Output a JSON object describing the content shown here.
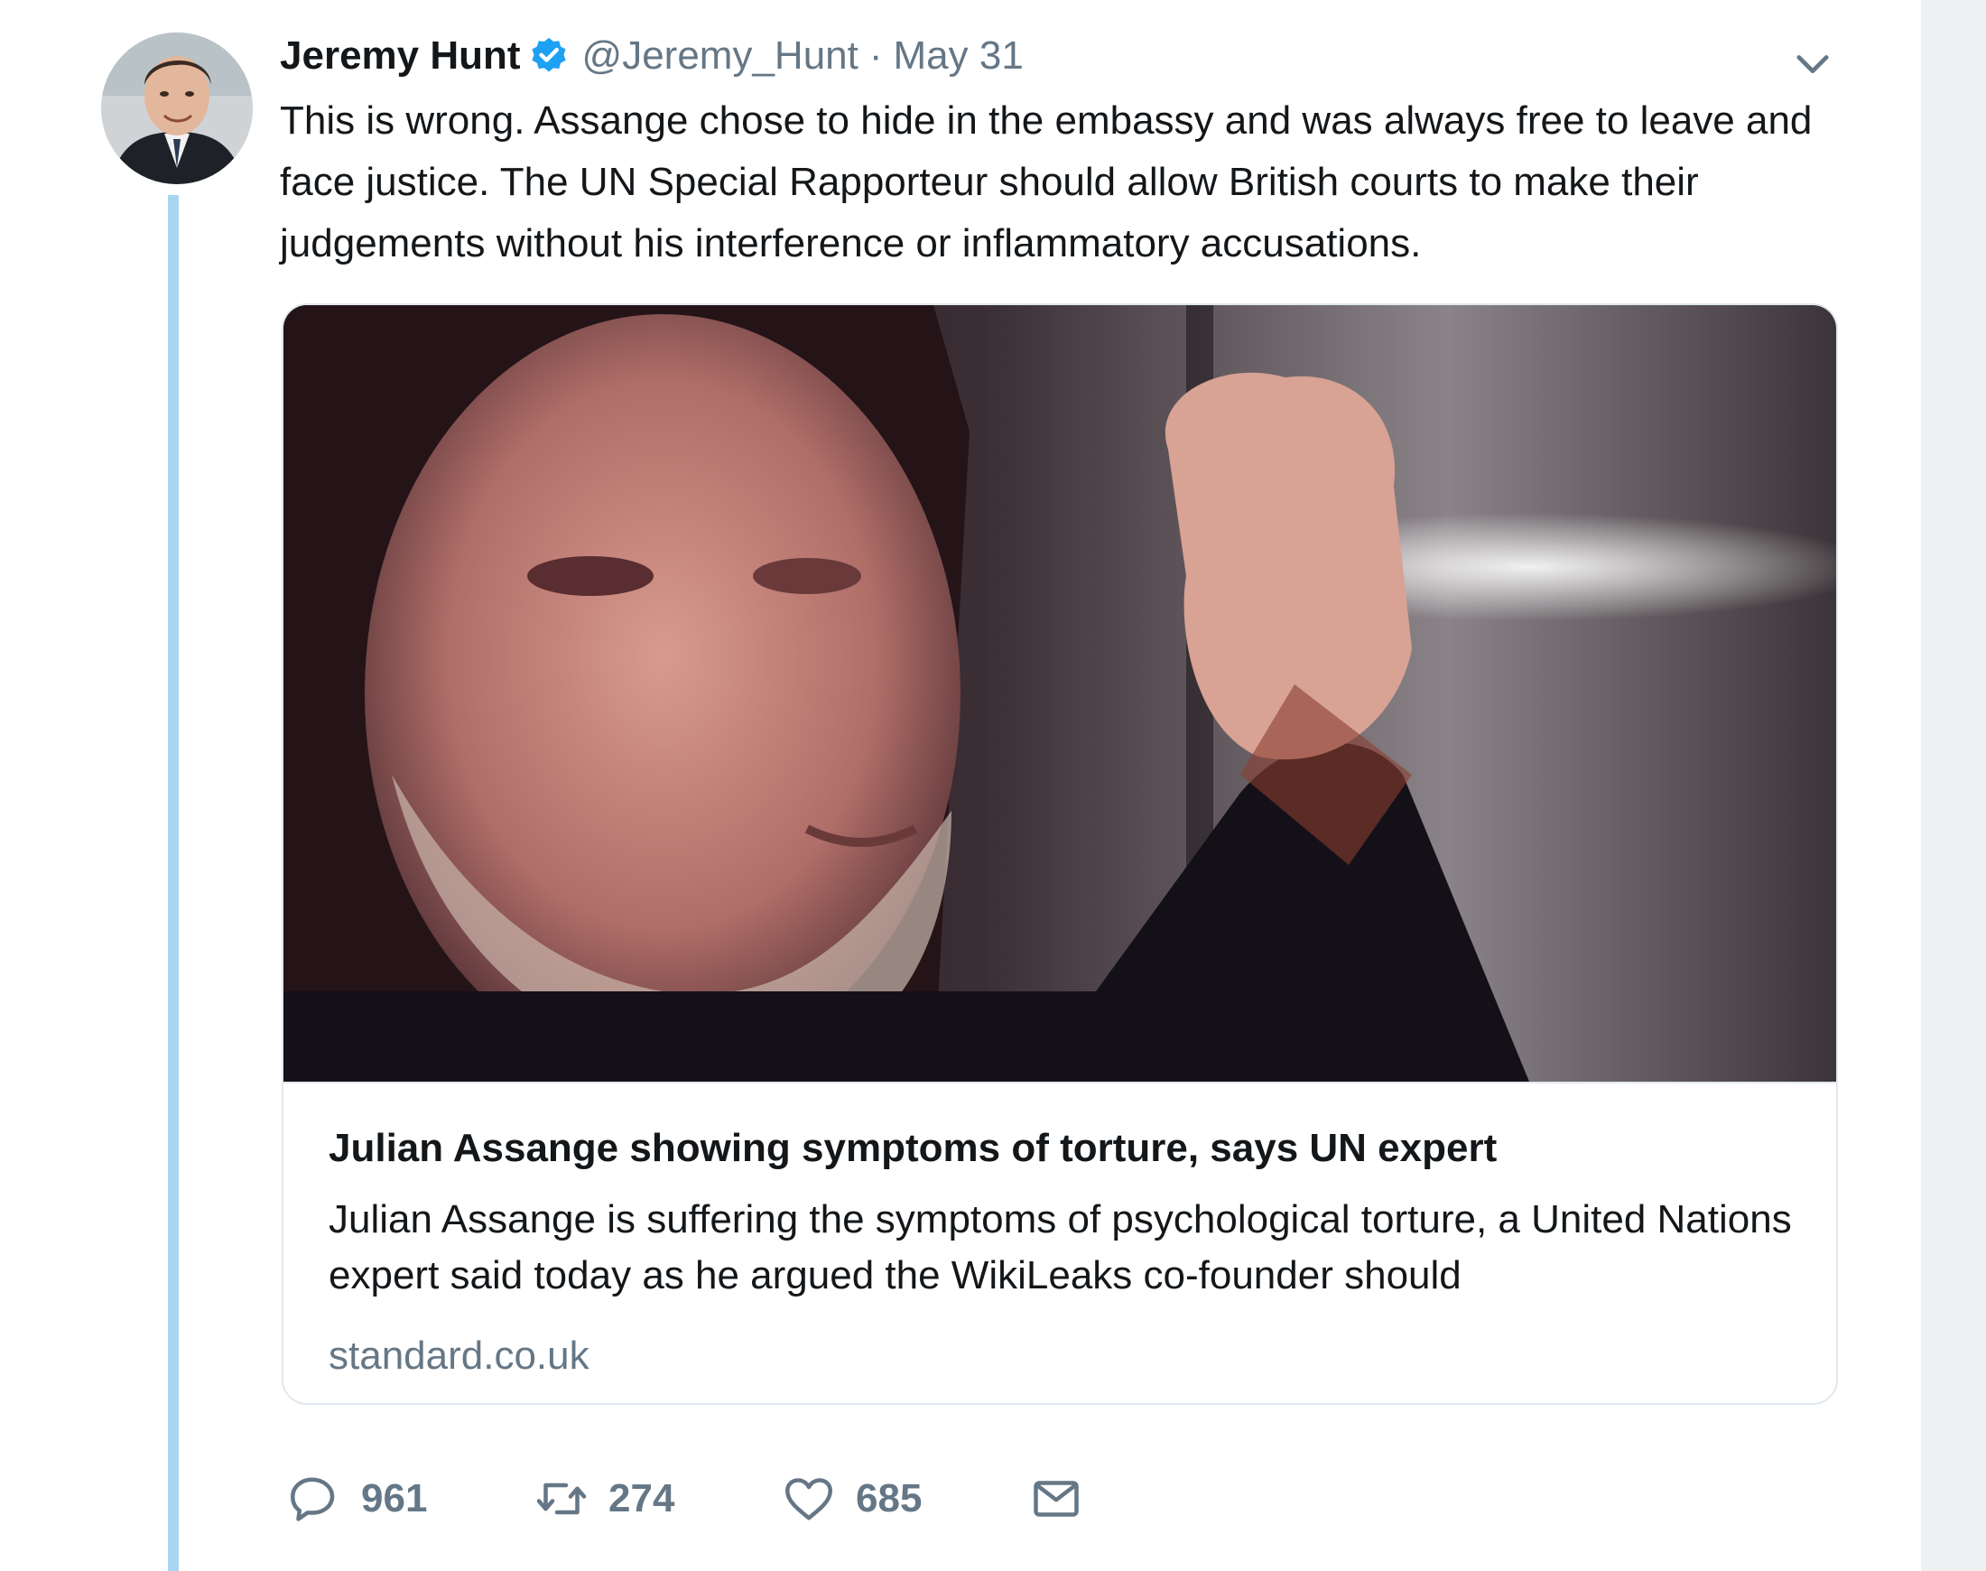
{
  "tweet": {
    "author_name": "Jeremy Hunt",
    "handle": "@Jeremy_Hunt",
    "separator": "·",
    "date": "May 31",
    "text": "This is wrong. Assange chose to hide in the embassy and was always free to leave and face justice. The UN Special Rapporteur should allow British courts to make their judgements without his interference or inflammatory accusations."
  },
  "card": {
    "title": "Julian Assange showing symptoms of torture, says UN expert",
    "description": "Julian Assange is suffering the symptoms of psychological torture, a United Nations expert said today as he argued the WikiLeaks co-founder should",
    "domain": "standard.co.uk"
  },
  "actions": {
    "replies": "961",
    "retweets": "274",
    "likes": "685"
  },
  "icons": {
    "verified": "verified-badge-icon",
    "caret": "chevron-down-icon",
    "reply": "reply-icon",
    "retweet": "retweet-icon",
    "like": "heart-icon",
    "dm": "envelope-icon"
  },
  "colors": {
    "text": "#14171a",
    "secondary": "#657786",
    "verified": "#1da1f2",
    "thread_line": "#a8d6f2",
    "border": "#e1e8ed"
  }
}
